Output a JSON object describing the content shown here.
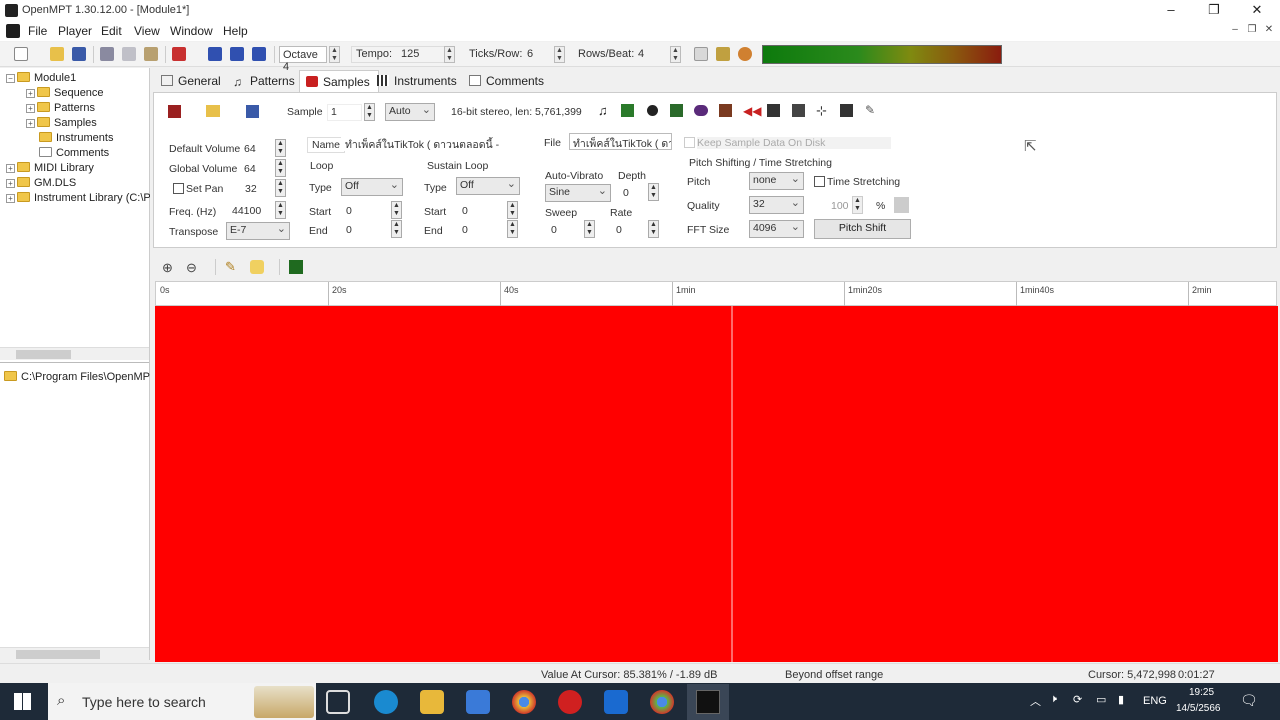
{
  "window": {
    "title": "OpenMPT 1.30.12.00 - [Module1*]"
  },
  "menu": [
    "File",
    "Player",
    "Edit",
    "View",
    "Window",
    "Help"
  ],
  "toolbar": {
    "octave": "Octave 4",
    "tempo_label": "Tempo:",
    "tempo_value": "125",
    "ticks_label": "Ticks/Row:",
    "ticks_value": "6",
    "rows_label": "Rows/Beat:",
    "rows_value": "4"
  },
  "tree": {
    "root": "Module1",
    "children": [
      "Sequence",
      "Patterns",
      "Samples",
      "Instruments",
      "Comments"
    ],
    "others": [
      "MIDI Library",
      "GM.DLS",
      "Instrument Library (C:\\P"
    ],
    "path": "C:\\Program Files\\OpenMPT"
  },
  "tabs": [
    "General",
    "Patterns",
    "Samples",
    "Instruments",
    "Comments"
  ],
  "sample": {
    "sample_label": "Sample",
    "sample_number": "1",
    "mode": "Auto",
    "info": "16-bit stereo, len: 5,761,399",
    "default_volume_label": "Default Volume",
    "default_volume": "64",
    "global_volume_label": "Global Volume",
    "global_volume": "64",
    "set_pan_label": "Set Pan",
    "set_pan": "32",
    "freq_label": "Freq. (Hz)",
    "freq": "44100",
    "transpose_label": "Transpose",
    "transpose": "E-7",
    "name_label": "Name",
    "name": "ทำเพ็คส์ในTikTok ( ดาวนตลอดนี้ -",
    "file_label": "File",
    "file": "ทำเพ็คส์ในTikTok ( ดาว",
    "keep_on_disk": "Keep Sample Data On Disk",
    "loop_label": "Loop",
    "sustain_label": "Sustain Loop",
    "type_label": "Type",
    "loop_type": "Off",
    "sustain_type": "Off",
    "start_label": "Start",
    "end_label": "End",
    "loop_start": "0",
    "loop_end": "0",
    "sustain_start": "0",
    "sustain_end": "0",
    "autovib_label": "Auto-Vibrato",
    "depth_label": "Depth",
    "vib_type": "Sine",
    "depth": "0",
    "sweep_label": "Sweep",
    "sweep": "0",
    "rate_label": "Rate",
    "rate": "0",
    "pitch_group": "Pitch Shifting / Time Stretching",
    "pitch_label": "Pitch",
    "pitch": "none",
    "time_stretch_label": "Time Stretching",
    "quality_label": "Quality",
    "quality": "32",
    "percent_value": "100",
    "percent_sign": "%",
    "fft_label": "FFT Size",
    "fft": "4096",
    "pitch_shift_button": "Pitch Shift"
  },
  "ruler": [
    "0s",
    "20s",
    "40s",
    "1min",
    "1min20s",
    "1min40s",
    "2min"
  ],
  "status": {
    "value": "Value At Cursor: 85.381% / -1.89 dB",
    "offset": "Beyond offset range",
    "cursor": "Cursor: 5,472,998",
    "time": "0:01:27"
  },
  "taskbar": {
    "search_placeholder": "Type here to search",
    "lang": "ENG",
    "clock": "19:25",
    "date": "14/5/2566"
  },
  "colors": {
    "waveform": "#ff0000",
    "titlebar": "#ffffff",
    "taskbar": "#1e2a38"
  }
}
